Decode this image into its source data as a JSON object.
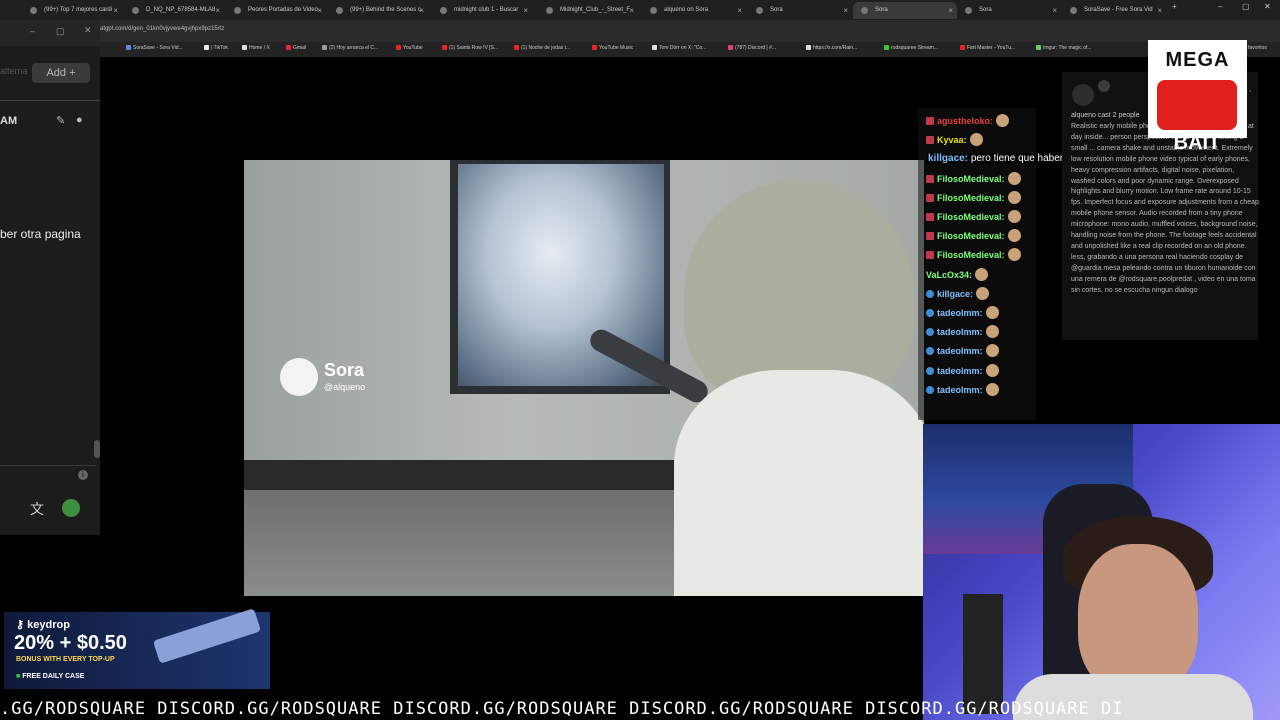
{
  "browser": {
    "tabs": [
      {
        "label": "(99+) Top 7 mejores cardi"
      },
      {
        "label": "D_NQ_NP_678584-MLA8"
      },
      {
        "label": "Peores Portadas de Video"
      },
      {
        "label": "(99+) Behind the Scenes c"
      },
      {
        "label": "midnight club 1 - Buscar"
      },
      {
        "label": "Midnight_Club_-_Street_F"
      },
      {
        "label": "alqueno on Sora"
      },
      {
        "label": "Sora"
      },
      {
        "label": "Sora"
      },
      {
        "label": "Sora"
      },
      {
        "label": "SoraSave - Free Sora Vid"
      }
    ],
    "url": "atgpt.com/d/gen_01kn0vjyvwe4gvjhpx9pz15rtz",
    "bookmarks": [
      {
        "label": "SoraSave - Sora Vid..."
      },
      {
        "label": "| TikTok"
      },
      {
        "label": "Home / X"
      },
      {
        "label": "Gmail"
      },
      {
        "label": "(2) Hoy arranca el C..."
      },
      {
        "label": "YouTube"
      },
      {
        "label": "(1) Saints Row IV [S..."
      },
      {
        "label": "(1) Noche de jodas t..."
      },
      {
        "label": "YouTube Music"
      },
      {
        "label": "Tom Dörr on X: \"Co..."
      },
      {
        "label": "(787) Discord | #..."
      },
      {
        "label": "https://x.com/Rain..."
      },
      {
        "label": "rodsquaree Stream..."
      },
      {
        "label": "Fart Master - YouTu..."
      },
      {
        "label": "Imgur: The magic of..."
      },
      {
        "label": "favoritos"
      }
    ]
  },
  "left_panel": {
    "ghost_text": "alterna",
    "add_button": "Add",
    "time_label": "AM",
    "message": "ber otra pagina"
  },
  "video": {
    "watermark_name": "Sora",
    "watermark_handle": "@alqueno"
  },
  "chat": {
    "lines": [
      {
        "user": "agustheloko:",
        "color": "#e0413a",
        "badge": "sq"
      },
      {
        "user": "Kyvaa:",
        "color": "#e4e000",
        "badge": "sq"
      },
      {
        "user": "killgace:",
        "color": "#7ec0ff",
        "badge": "round",
        "text": "pero tiene que haber otra pagina para descargar"
      },
      {
        "user": "FilosoMedieval:",
        "color": "#7dff7d",
        "badge": "sq"
      },
      {
        "user": "FilosoMedieval:",
        "color": "#7dff7d",
        "badge": "sq"
      },
      {
        "user": "FilosoMedieval:",
        "color": "#7dff7d",
        "badge": "sq"
      },
      {
        "user": "FilosoMedieval:",
        "color": "#7dff7d",
        "badge": "sq"
      },
      {
        "user": "FilosoMedieval:",
        "color": "#7dff7d",
        "badge": "sq"
      },
      {
        "user": "VaLcOx34:",
        "color": "#7dff7d",
        "badge": "none"
      },
      {
        "user": "killgace:",
        "color": "#7ec0ff",
        "badge": "round"
      },
      {
        "user": "tadeolmm:",
        "color": "#7ec0ff",
        "badge": "round"
      },
      {
        "user": "tadeolmm:",
        "color": "#7ec0ff",
        "badge": "round"
      },
      {
        "user": "tadeolmm:",
        "color": "#7ec0ff",
        "badge": "round"
      },
      {
        "user": "tadeolmm:",
        "color": "#7ec0ff",
        "badge": "round"
      },
      {
        "user": "tadeolmm:",
        "color": "#7ec0ff",
        "badge": "round"
      }
    ]
  },
  "sora_panel": {
    "user": "alqueno  cast 2 people",
    "prompt": "Realistic early mobile phone footage from the mid-2000s at day inside... person perspective with a person holding a small ... camera shake and unstable movement. Extremely low resolution mobile phone video typical of early phones, heavy compression artifacts, digital noise, pixelation, washed colors and poor dynamic range. Overexposed highlights and blurry motion. Low frame rate around 10-15 fps. Imperfect focus and exposure adjustments from a cheap mobile phone sensor. Audio recorded from a tiny phone microphone: mono audio, muffled voices, background noise, handling noise from the phone. The footage feels accidental and unpolished like a real clip recorded on an old phone. less, grabando a una persona real haciendo cosplay de @guardia.mesa peleando contra un tiburon humanoide con una remera de @rodsquare.poolpredat , video en una toma sin cortes, no se escucha ningun dialogo"
  },
  "overlay": {
    "mega": "MEGA",
    "bait": "BAIT"
  },
  "ad": {
    "brand": "keydrop",
    "promo": "20% + $0.50",
    "bonus": "BONUS WITH EVERY TOP-UP",
    "free_case": "FREE DAILY CASE"
  },
  "ticker": {
    "text": ".GG/RODSQUARE DISCORD.GG/RODSQUARE DISCORD.GG/RODSQUARE DISCORD.GG/RODSQUARE DISCORD.GG/RODSQUARE DI"
  }
}
